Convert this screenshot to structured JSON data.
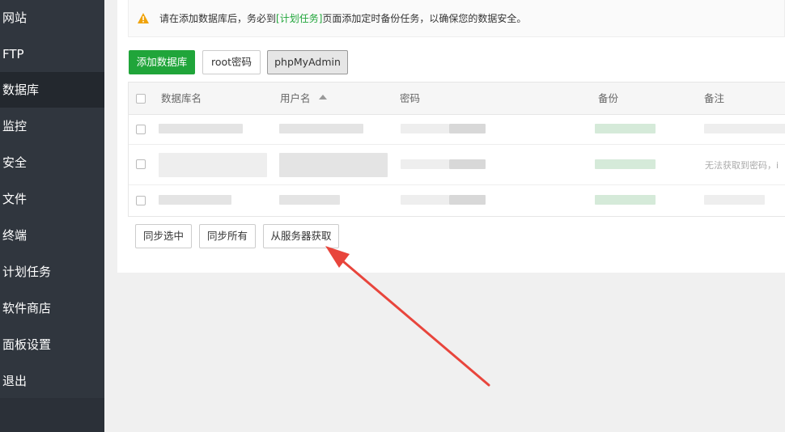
{
  "sidebar": {
    "items": [
      {
        "label": "网站"
      },
      {
        "label": "FTP"
      },
      {
        "label": "数据库"
      },
      {
        "label": "监控"
      },
      {
        "label": "安全"
      },
      {
        "label": "文件"
      },
      {
        "label": "终端"
      },
      {
        "label": "计划任务"
      },
      {
        "label": "软件商店"
      },
      {
        "label": "面板设置"
      },
      {
        "label": "退出"
      }
    ],
    "active": "数据库"
  },
  "notice": {
    "before": "请在添加数据库后，务必到",
    "link": "[计划任务]",
    "after": "页面添加定时备份任务，以确保您的数据安全。"
  },
  "toolbar": {
    "add_label": "添加数据库",
    "root_label": "root密码",
    "phpmyadmin_label": "phpMyAdmin"
  },
  "table": {
    "columns": [
      "数据库名",
      "用户名",
      "密码",
      "备份",
      "备注"
    ],
    "sorted_column": "用户名",
    "row2_note": "无法获取到密码，i"
  },
  "footer": {
    "sync_selected_label": "同步选中",
    "sync_all_label": "同步所有",
    "fetch_server_label": "从服务器获取"
  },
  "colors": {
    "accent": "#20a53a",
    "annotation_arrow": "#e8453c"
  }
}
